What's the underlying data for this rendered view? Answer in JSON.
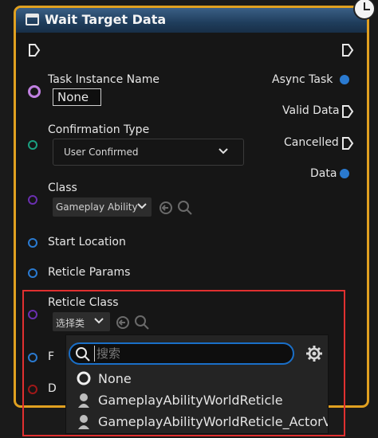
{
  "node": {
    "title": "Wait Target Data",
    "header_color": "#2a4a6e",
    "border_color": "#e0a020"
  },
  "inputs": {
    "task_instance_name": {
      "label": "Task Instance Name",
      "value": "None",
      "pin_color": "#c080e0"
    },
    "confirmation_type": {
      "label": "Confirmation Type",
      "value": "User Confirmed",
      "pin_color": "#1aa080"
    },
    "class": {
      "label": "Class",
      "value": "Gameplay Ability",
      "pin_color": "#6a2fb0"
    },
    "start_location": {
      "label": "Start Location",
      "pin_color": "#2a7ad0"
    },
    "reticle_params": {
      "label": "Reticle Params",
      "pin_color": "#2a7ad0"
    },
    "reticle_class": {
      "label": "Reticle Class",
      "value": "选择类",
      "pin_color": "#6a2fb0"
    },
    "partial_label_1": "F",
    "partial_label_2": "D"
  },
  "outputs": {
    "async_task": {
      "label": "Async Task",
      "pin_color": "#2a7ad0"
    },
    "valid_data": {
      "label": "Valid Data"
    },
    "cancelled": {
      "label": "Cancelled"
    },
    "data": {
      "label": "Data",
      "pin_color": "#2a7ad0"
    }
  },
  "class_picker": {
    "search_placeholder": "搜索",
    "items": [
      {
        "label": "None",
        "icon": "none-circle-icon"
      },
      {
        "label": "GameplayAbilityWorldReticle",
        "icon": "actor-class-icon"
      },
      {
        "label": "GameplayAbilityWorldReticle_ActorV",
        "icon": "actor-class-icon"
      }
    ]
  }
}
